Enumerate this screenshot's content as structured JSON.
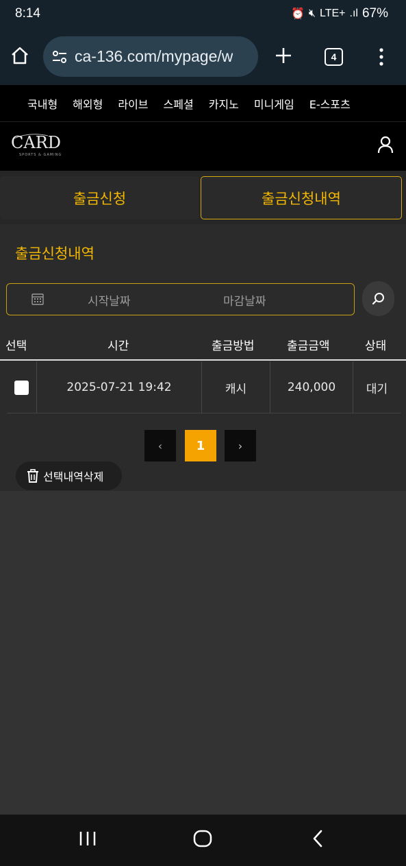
{
  "status_bar": {
    "time": "8:14",
    "network": "LTE+",
    "battery": "67%"
  },
  "browser": {
    "url": "ca-136.com/mypage/w",
    "tab_count": "4"
  },
  "category_nav": {
    "items": [
      "국내형",
      "해외형",
      "라이브",
      "스페셜",
      "카지노",
      "미니게임",
      "E-스포츠"
    ]
  },
  "logo": {
    "text": "CARD",
    "subtext": "SPORTS & GAMING"
  },
  "tabs": [
    {
      "label": "출금신청",
      "active": false
    },
    {
      "label": "출금신청내역",
      "active": true
    }
  ],
  "section": {
    "title": "출금신청내역"
  },
  "date_filter": {
    "start_placeholder": "시작날짜",
    "end_placeholder": "마감날짜"
  },
  "table": {
    "headers": [
      "선택",
      "시간",
      "출금방법",
      "출금금액",
      "상태"
    ],
    "rows": [
      {
        "time": "2025-07-21 19:42",
        "method": "캐시",
        "amount": "240,000",
        "status": "대기",
        "checked": false
      }
    ]
  },
  "pagination": {
    "current_page": "1",
    "prev": "‹",
    "next": "›"
  },
  "actions": {
    "delete_selected": "선택내역삭제"
  },
  "colors": {
    "accent": "#f5b800",
    "page_active": "#f5a300",
    "background": "#333333"
  }
}
